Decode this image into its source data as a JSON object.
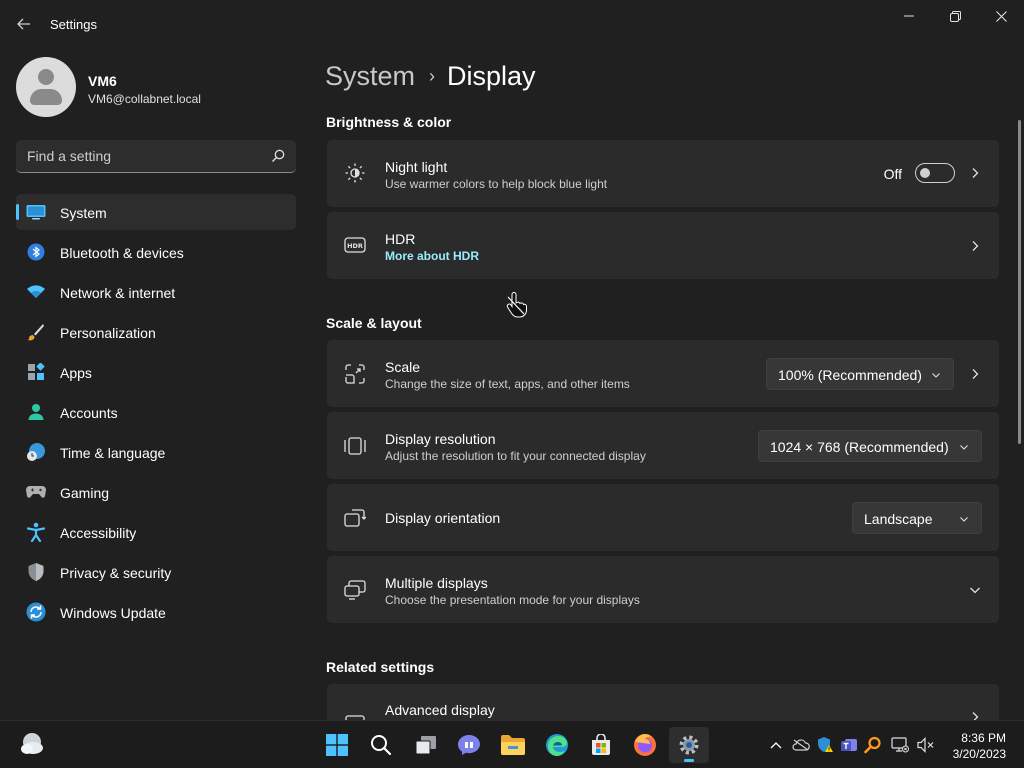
{
  "window": {
    "title": "Settings"
  },
  "profile": {
    "name": "VM6",
    "email": "VM6@collabnet.local"
  },
  "search": {
    "placeholder": "Find a setting"
  },
  "sidebar": {
    "items": [
      {
        "label": "System",
        "icon": "system-icon",
        "active": true
      },
      {
        "label": "Bluetooth & devices",
        "icon": "bluetooth-icon"
      },
      {
        "label": "Network & internet",
        "icon": "wifi-icon"
      },
      {
        "label": "Personalization",
        "icon": "brush-icon"
      },
      {
        "label": "Apps",
        "icon": "apps-icon"
      },
      {
        "label": "Accounts",
        "icon": "accounts-icon"
      },
      {
        "label": "Time & language",
        "icon": "clock-globe-icon"
      },
      {
        "label": "Gaming",
        "icon": "gamepad-icon"
      },
      {
        "label": "Accessibility",
        "icon": "accessibility-icon"
      },
      {
        "label": "Privacy & security",
        "icon": "shield-icon"
      },
      {
        "label": "Windows Update",
        "icon": "update-icon"
      }
    ]
  },
  "breadcrumb": {
    "parent": "System",
    "separator": "›",
    "current": "Display"
  },
  "sections": {
    "brightness": "Brightness & color",
    "scale_layout": "Scale & layout",
    "related": "Related settings"
  },
  "cards": {
    "night_light": {
      "title": "Night light",
      "subtitle": "Use warmer colors to help block blue light",
      "state_label": "Off",
      "enabled": false
    },
    "hdr": {
      "title": "HDR",
      "link": "More about HDR"
    },
    "scale": {
      "title": "Scale",
      "subtitle": "Change the size of text, apps, and other items",
      "value": "100% (Recommended)"
    },
    "resolution": {
      "title": "Display resolution",
      "subtitle": "Adjust the resolution to fit your connected display",
      "value": "1024 × 768 (Recommended)"
    },
    "orientation": {
      "title": "Display orientation",
      "value": "Landscape"
    },
    "multiple": {
      "title": "Multiple displays",
      "subtitle": "Choose the presentation mode for your displays"
    },
    "advanced": {
      "title": "Advanced display"
    }
  },
  "taskbar": {
    "apps": [
      "start-icon",
      "search-icon",
      "task-view-icon",
      "chat-icon",
      "file-explorer-icon",
      "edge-icon",
      "store-icon",
      "firefox-icon",
      "settings-icon"
    ],
    "active_app": "settings-icon",
    "clock": {
      "time": "8:36 PM",
      "date": "3/20/2023"
    }
  },
  "colors": {
    "accent": "#4cc2ff",
    "link": "#99ebff",
    "background": "#202020",
    "card": "#2b2b2b"
  }
}
